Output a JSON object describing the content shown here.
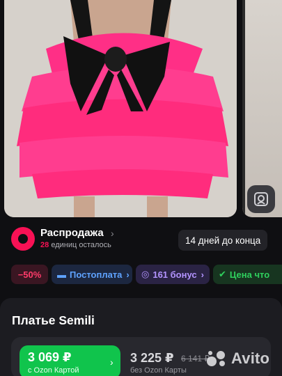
{
  "gallery": {
    "current_photo": "dress-photo",
    "visual_search_icon": "image-search-icon"
  },
  "promo": {
    "title": "Распродажа",
    "remaining_count": "28",
    "remaining_text": "единиц осталось",
    "countdown": "14 дней до конца",
    "accent": "#f91155"
  },
  "badges": {
    "discount": "−50%",
    "postpay": "Постоплата",
    "bonus": "161 бонус",
    "price_guarantee": "Цена что"
  },
  "product": {
    "title": "Платье Semili",
    "ozon_price": "3 069 ₽",
    "ozon_price_sub": "с Ozon Картой",
    "regular_price": "3 225 ₽",
    "old_price": "6 141 ₽",
    "regular_sub": "без Ozon Карты"
  },
  "watermark": {
    "text": "Avito"
  },
  "colors": {
    "ozon_green": "#10c44c",
    "postpay_blue": "#5fa3ff",
    "bonus_purple": "#b394ff"
  }
}
